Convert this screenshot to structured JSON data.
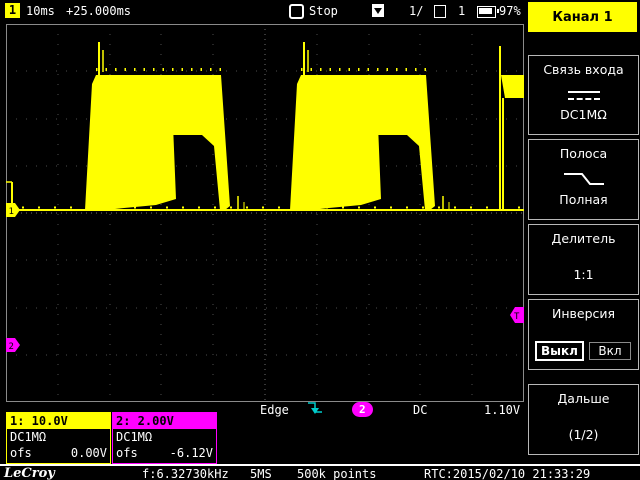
{
  "topbar": {
    "channel_badge": "1",
    "timebase": "10ms",
    "trigger_delay": "+25.000ms",
    "acquisition_status": "Stop",
    "segment_prefix": "1/",
    "segment_count": "1",
    "battery_percent": "97%"
  },
  "menu": {
    "title": "Канал 1",
    "coupling": {
      "label": "Связь входа",
      "value": "DC1MΩ"
    },
    "bandwidth": {
      "label": "Полоса",
      "value": "Полная"
    },
    "attenuation": {
      "label": "Делитель",
      "value": "1:1"
    },
    "invert": {
      "label": "Инверсия",
      "off_label": "Выкл",
      "on_label": "Вкл"
    },
    "next": {
      "label": "Дальше",
      "value": "(1/2)"
    }
  },
  "channel1": {
    "marker": "1",
    "scale": "1: 10.0V",
    "coupling": "DC1MΩ",
    "offset_label": "ofs",
    "offset_value": "0.00V"
  },
  "channel2": {
    "marker": "2",
    "scale": "2: 2.00V",
    "coupling": "DC1MΩ",
    "offset_label": "ofs",
    "offset_value": "-6.12V"
  },
  "trigger": {
    "mode": "Edge",
    "source": "2",
    "coupling": "DC",
    "level": "1.10V",
    "marker": "T"
  },
  "statusbar": {
    "logo": "LeCroy",
    "frequency": "f:6.32730kHz",
    "sample_rate": "5MS",
    "memory": "500k points",
    "clock": "RTC:2015/02/10 21:33:29"
  },
  "colors": {
    "ch1": "#ffff00",
    "ch2": "#ff00ff",
    "trigger_icon": "#00cccc"
  }
}
